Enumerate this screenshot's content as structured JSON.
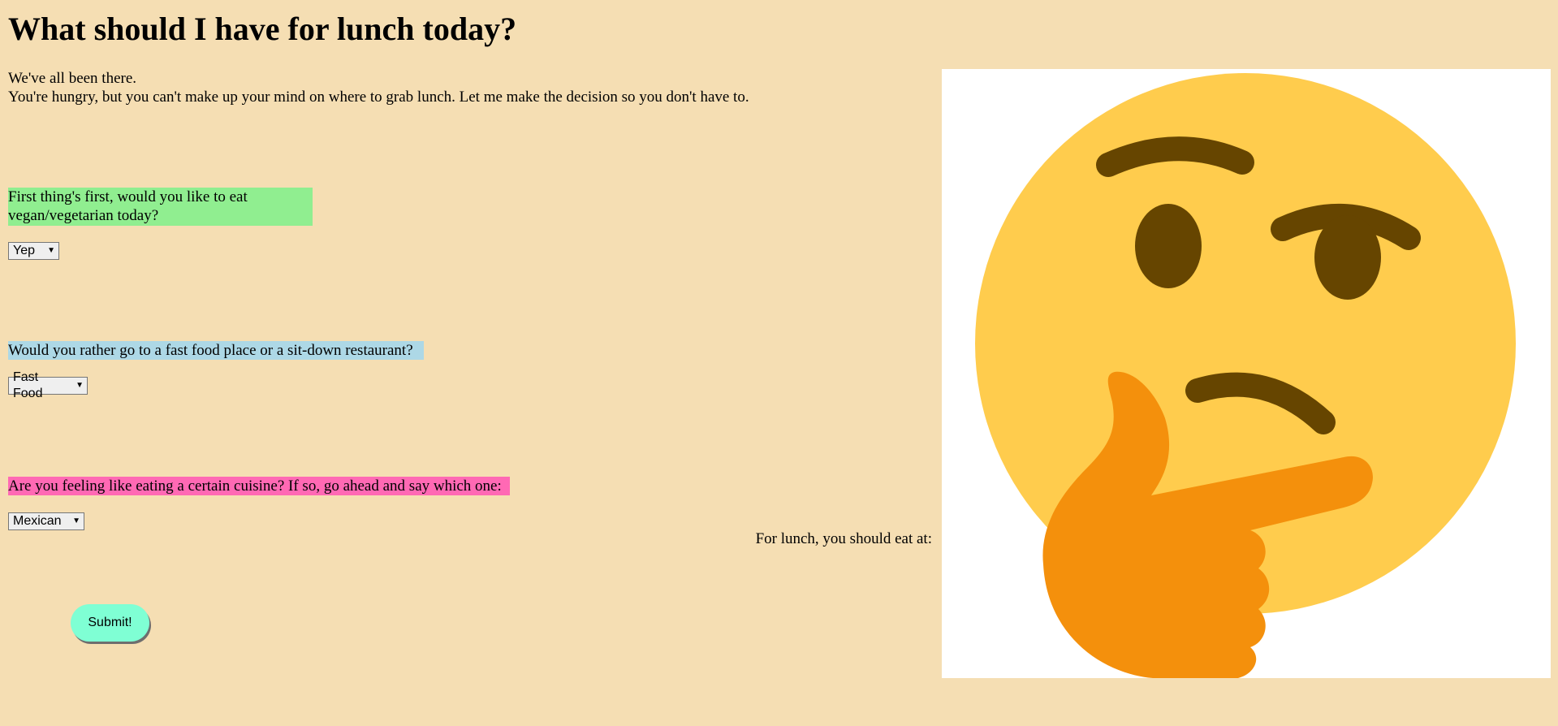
{
  "header": {
    "title": "What should I have for lunch today?"
  },
  "intro": {
    "line1": "We've all been there.",
    "line2": "You're hungry, but you can't make up your mind on where to grab lunch. Let me make the decision so you don't have to."
  },
  "questions": [
    {
      "text": "First thing's first, would you like to eat vegan/vegetarian today?",
      "selected": "Yep",
      "color": "#90ee90"
    },
    {
      "text": "Would you rather go to a fast food place or a sit-down restaurant?",
      "selected": "Fast Food",
      "color": "#add8e6"
    },
    {
      "text": "Are you feeling like eating a certain cuisine? If so, go ahead and say which one:",
      "selected": "Mexican",
      "color": "#ff69b4"
    }
  ],
  "result": {
    "label": "For lunch, you should eat at:"
  },
  "submit": {
    "label": "Submit!",
    "color": "#7fffd4"
  },
  "image": {
    "icon": "thinking-face-emoji",
    "face_color": "#ffcc4d",
    "feature_color": "#664500",
    "hand_color": "#f4900c"
  },
  "colors": {
    "background": "#f5deb3"
  }
}
